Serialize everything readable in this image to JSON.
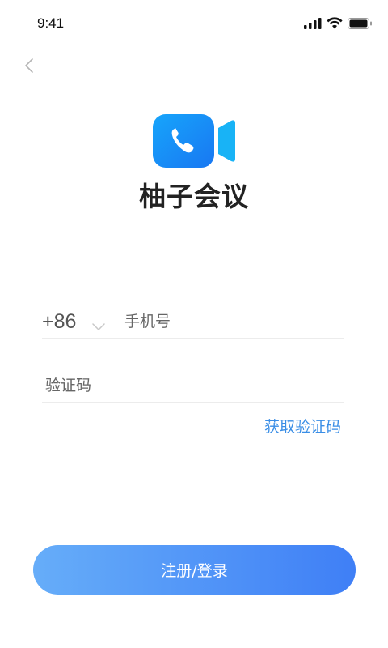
{
  "status_bar": {
    "time": "9:41",
    "signal_icon": "cellular-signal-icon",
    "wifi_icon": "wifi-icon",
    "battery_icon": "battery-icon"
  },
  "nav": {
    "back_icon": "chevron-left-icon"
  },
  "app": {
    "logo_icon": "video-call-icon",
    "name": "柚子会议",
    "brand_color": "#1e9bf8"
  },
  "form": {
    "country_code": "+86",
    "country_chevron_icon": "chevron-down-icon",
    "phone_placeholder": "手机号",
    "phone_value": "",
    "code_placeholder": "验证码",
    "code_value": "",
    "get_code_label": "获取验证码",
    "link_color": "#3a8ee6"
  },
  "actions": {
    "submit_label": "注册/登录",
    "gradient_start": "#66adf9",
    "gradient_end": "#3f7ff6"
  }
}
